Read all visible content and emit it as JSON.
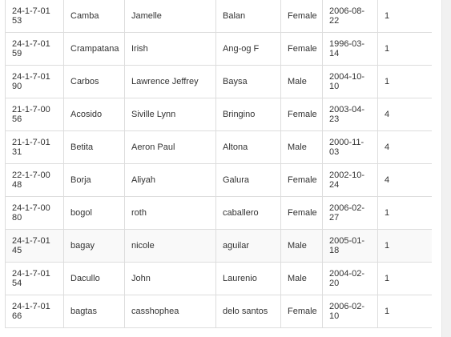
{
  "rows": [
    {
      "id": "24-1-7-0153",
      "last": "Camba",
      "first": "Jamelle",
      "middle": "Balan",
      "sex": "Female",
      "dob": "2006-08-22",
      "year": "1"
    },
    {
      "id": "24-1-7-0159",
      "last": "Crampatana",
      "first": "Irish",
      "middle": "Ang-og F",
      "sex": "Female",
      "dob": "1996-03-14",
      "year": "1"
    },
    {
      "id": "24-1-7-0190",
      "last": "Carbos",
      "first": "Lawrence Jeffrey",
      "middle": "Baysa",
      "sex": "Male",
      "dob": "2004-10-10",
      "year": "1"
    },
    {
      "id": "21-1-7-0056",
      "last": "Acosido",
      "first": "Siville Lynn",
      "middle": "Bringino",
      "sex": "Female",
      "dob": "2003-04-23",
      "year": "4"
    },
    {
      "id": "21-1-7-0131",
      "last": "Betita",
      "first": "Aeron Paul",
      "middle": "Altona",
      "sex": "Male",
      "dob": "2000-11-03",
      "year": "4"
    },
    {
      "id": "22-1-7-0048",
      "last": "Borja",
      "first": "Aliyah",
      "middle": "Galura",
      "sex": "Female",
      "dob": "2002-10-24",
      "year": "4"
    },
    {
      "id": "24-1-7-0080",
      "last": "bogol",
      "first": "roth",
      "middle": "caballero",
      "sex": "Female",
      "dob": "2006-02-27",
      "year": "1"
    },
    {
      "id": "24-1-7-0145",
      "last": "bagay",
      "first": "nicole",
      "middle": "aguilar",
      "sex": "Male",
      "dob": "2005-01-18",
      "year": "1"
    },
    {
      "id": "24-1-7-0154",
      "last": "Dacullo",
      "first": "John",
      "middle": "Laurenio",
      "sex": "Male",
      "dob": "2004-02-20",
      "year": "1"
    },
    {
      "id": "24-1-7-0166",
      "last": "bagtas",
      "first": "casshophea",
      "middle": "delo santos",
      "sex": "Female",
      "dob": "2006-02-10",
      "year": "1"
    }
  ]
}
